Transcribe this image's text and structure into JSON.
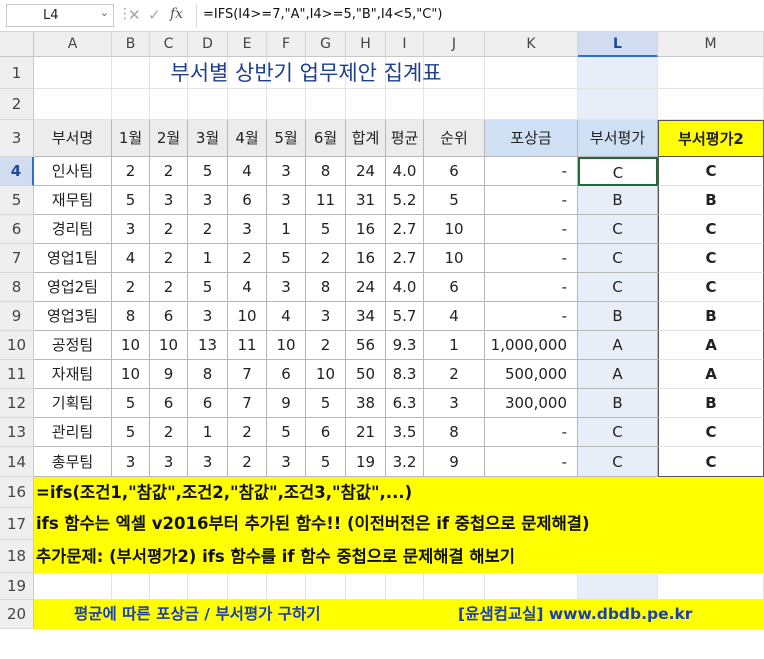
{
  "formula_bar": {
    "name_box": "L4",
    "formula": "=IFS(I4>=7,\"A\",I4>=5,\"B\",I4<5,\"C\")"
  },
  "columns": [
    "A",
    "B",
    "C",
    "D",
    "E",
    "F",
    "G",
    "H",
    "I",
    "J",
    "K",
    "L",
    "M"
  ],
  "rows": [
    "1",
    "2",
    "3",
    "4",
    "5",
    "6",
    "7",
    "8",
    "9",
    "10",
    "11",
    "12",
    "13",
    "14",
    "16",
    "17",
    "18",
    "19",
    "20"
  ],
  "sheet_title": "부서별 상반기 업무제안 집계표",
  "table_headers": [
    "부서명",
    "1월",
    "2월",
    "3월",
    "4월",
    "5월",
    "6월",
    "합계",
    "평균",
    "순위",
    "포상금",
    "부서평가",
    "부서평가2"
  ],
  "table_rows": [
    [
      "인사팀",
      "2",
      "2",
      "5",
      "4",
      "3",
      "8",
      "24",
      "4.0",
      "6",
      "-",
      "C",
      "C"
    ],
    [
      "재무팀",
      "5",
      "3",
      "3",
      "6",
      "3",
      "11",
      "31",
      "5.2",
      "5",
      "-",
      "B",
      "B"
    ],
    [
      "경리팀",
      "3",
      "2",
      "2",
      "3",
      "1",
      "5",
      "16",
      "2.7",
      "10",
      "-",
      "C",
      "C"
    ],
    [
      "영업1팀",
      "4",
      "2",
      "1",
      "2",
      "5",
      "2",
      "16",
      "2.7",
      "10",
      "-",
      "C",
      "C"
    ],
    [
      "영업2팀",
      "2",
      "2",
      "5",
      "4",
      "3",
      "8",
      "24",
      "4.0",
      "6",
      "-",
      "C",
      "C"
    ],
    [
      "영업3팀",
      "8",
      "6",
      "3",
      "10",
      "4",
      "3",
      "34",
      "5.7",
      "4",
      "-",
      "B",
      "B"
    ],
    [
      "공정팀",
      "10",
      "10",
      "13",
      "11",
      "10",
      "2",
      "56",
      "9.3",
      "1",
      "1,000,000",
      "A",
      "A"
    ],
    [
      "자재팀",
      "10",
      "9",
      "8",
      "7",
      "6",
      "10",
      "50",
      "8.3",
      "2",
      "500,000",
      "A",
      "A"
    ],
    [
      "기획팀",
      "5",
      "6",
      "6",
      "7",
      "9",
      "5",
      "38",
      "6.3",
      "3",
      "300,000",
      "B",
      "B"
    ],
    [
      "관리팀",
      "5",
      "2",
      "1",
      "2",
      "5",
      "6",
      "21",
      "3.5",
      "8",
      "-",
      "C",
      "C"
    ],
    [
      "총무팀",
      "3",
      "3",
      "3",
      "2",
      "3",
      "5",
      "19",
      "3.2",
      "9",
      "-",
      "C",
      "C"
    ]
  ],
  "notes": {
    "row16": "=ifs(조건1,\"참값\",조건2,\"참값\",조건3,\"참값\",...)",
    "row17": "ifs 함수는 엑셀 v2016부터 추가된 함수!! (이전버전은 if 중첩으로 문제해결)",
    "row18": "추가문제: (부서평가2) ifs 함수를 if 함수 중첩으로 문제해결 해보기",
    "row20_left": "평균에 따른 포상금 / 부서평가 구하기",
    "row20_right": "[윤샘컴교실] www.dbdb.pe.kr"
  },
  "colors": {
    "highlight_yellow": "#ffff00",
    "title_blue": "#1d3f8f",
    "link_blue": "#1c3fb0",
    "selection_blue": "#d2dcf0",
    "active_border": "#1f6b3a"
  }
}
